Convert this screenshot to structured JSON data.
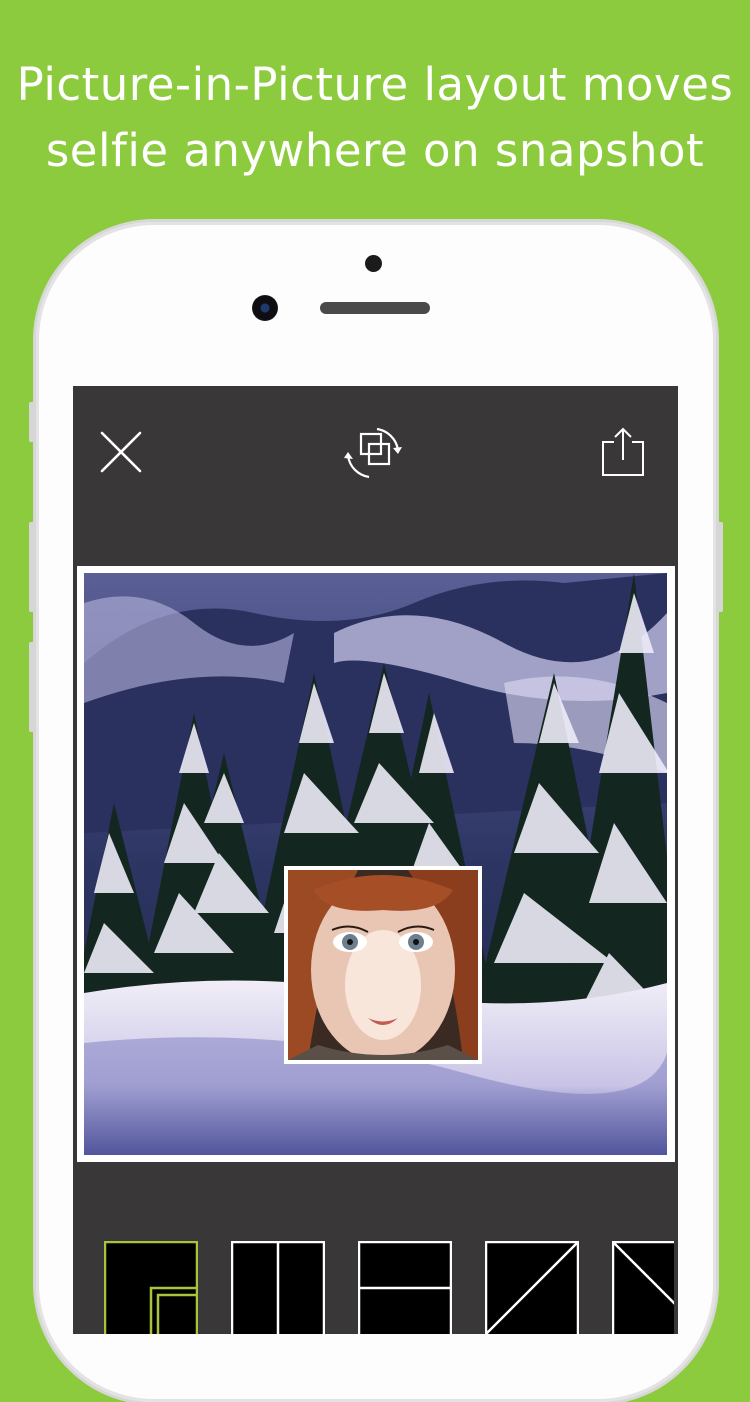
{
  "headline": {
    "line1": "Picture-in-Picture layout moves",
    "line2": "selfie anywhere on snapshot"
  },
  "colors": {
    "background": "#8dcb3e",
    "screen_bg": "#3a3738",
    "selected_layout_accent": "#a8c43a"
  },
  "toolbar": {
    "close_icon": "close-icon",
    "swap_icon": "swap-layers-icon",
    "share_icon": "share-icon"
  },
  "photo": {
    "main_subject": "snowy forest",
    "inset_subject": "selfie"
  },
  "layouts": [
    {
      "name": "picture-in-picture",
      "selected": true
    },
    {
      "name": "split-vertical",
      "selected": false
    },
    {
      "name": "split-horizontal",
      "selected": false
    },
    {
      "name": "diagonal",
      "selected": false
    },
    {
      "name": "diagonal-corner",
      "selected": false
    }
  ]
}
